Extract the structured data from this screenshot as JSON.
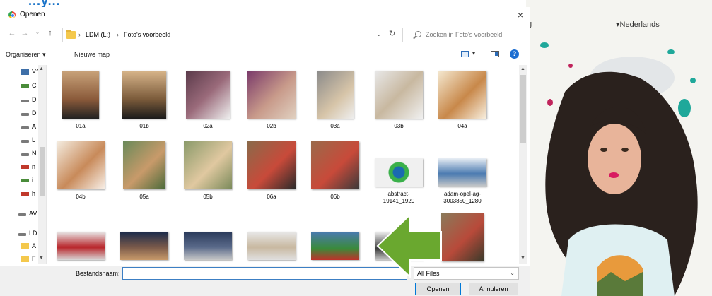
{
  "dialog": {
    "title": "Openen",
    "close_glyph": "×",
    "nav": {
      "back": "←",
      "forward": "→",
      "recent": "⌄",
      "up": "↑"
    },
    "breadcrumb": [
      {
        "label": "LDM (L:)"
      },
      {
        "label": "Foto's voorbeeld"
      }
    ],
    "crumb_separator": "›",
    "address_dropdown_glyph": "⌄",
    "refresh_glyph": "↻",
    "search_placeholder": "Zoeken in Foto's voorbeeld",
    "toolbar": {
      "organize": "Organiseren ▾",
      "new_folder": "Nieuwe map",
      "view_dropdown_glyph": "▾",
      "help": "?"
    },
    "navpane": [
      {
        "label": "V^",
        "icon": "pc-icon"
      },
      {
        "label": "C",
        "icon": "network-icon"
      },
      {
        "label": "D",
        "icon": "drive-icon"
      },
      {
        "label": "D",
        "icon": "drive-icon"
      },
      {
        "label": "A",
        "icon": "drive-icon"
      },
      {
        "label": "L",
        "icon": "drive-icon"
      },
      {
        "label": "N",
        "icon": "drive-icon"
      },
      {
        "label": "n",
        "icon": "usb-drive-icon"
      },
      {
        "label": "i",
        "icon": "network-drive-icon"
      },
      {
        "label": "h",
        "icon": "usb-drive-icon"
      },
      {
        "label": "AV",
        "icon": "drive-icon"
      },
      {
        "label": "LD",
        "icon": "drive-icon"
      },
      {
        "label": "A",
        "icon": "folder-icon"
      },
      {
        "label": "F",
        "icon": "folder-icon"
      }
    ],
    "files": [
      {
        "name": "01a"
      },
      {
        "name": "01b"
      },
      {
        "name": "02a"
      },
      {
        "name": "02b"
      },
      {
        "name": "03a"
      },
      {
        "name": "03b"
      },
      {
        "name": "04a"
      },
      {
        "name": "04b"
      },
      {
        "name": "05a"
      },
      {
        "name": "05b"
      },
      {
        "name": "06a"
      },
      {
        "name": "06b"
      },
      {
        "name": "abstract-19141_1920"
      },
      {
        "name": "adam-opel-ag-3003850_1280"
      },
      {
        "name": ""
      },
      {
        "name": ""
      },
      {
        "name": ""
      },
      {
        "name": ""
      },
      {
        "name": ""
      },
      {
        "name": ""
      },
      {
        "name": ""
      }
    ],
    "filename_label": "Bestandsnaam:",
    "filename_value": "",
    "file_type": "All Files",
    "file_type_dropdown_glyph": "⌄",
    "open_button": "Openen",
    "cancel_button": "Annuleren"
  },
  "background": {
    "language": "▾Nederlands",
    "partial_letter": "g",
    "partial_heading": "...y..."
  },
  "colors": {
    "accent": "#0078d7",
    "arrow": "#6aa82f"
  }
}
